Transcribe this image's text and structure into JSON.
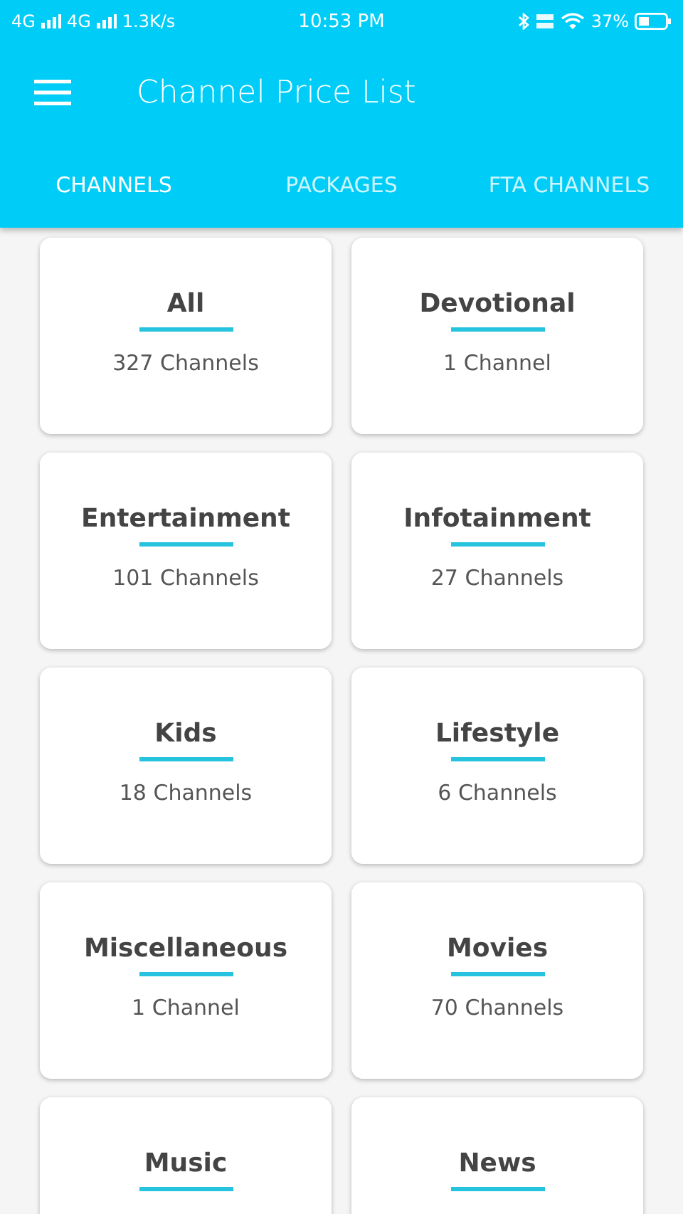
{
  "status_bar": {
    "network_1": "4G",
    "network_2": "4G",
    "speed": "1.3K/s",
    "time": "10:53 PM",
    "battery": "37%"
  },
  "app_bar": {
    "title": "Channel Price List"
  },
  "tabs": [
    {
      "label": "CHANNELS",
      "selected": true
    },
    {
      "label": "PACKAGES",
      "selected": false
    },
    {
      "label": "FTA CHANNELS",
      "selected": false
    }
  ],
  "categories": [
    {
      "name": "All",
      "count": "327 Channels"
    },
    {
      "name": "Devotional",
      "count": "1 Channel"
    },
    {
      "name": "Entertainment",
      "count": "101 Channels"
    },
    {
      "name": "Infotainment",
      "count": "27 Channels"
    },
    {
      "name": "Kids",
      "count": "18 Channels"
    },
    {
      "name": "Lifestyle",
      "count": "6 Channels"
    },
    {
      "name": "Miscellaneous",
      "count": "1 Channel"
    },
    {
      "name": "Movies",
      "count": "70 Channels"
    },
    {
      "name": "Music"
    },
    {
      "name": "News"
    }
  ]
}
